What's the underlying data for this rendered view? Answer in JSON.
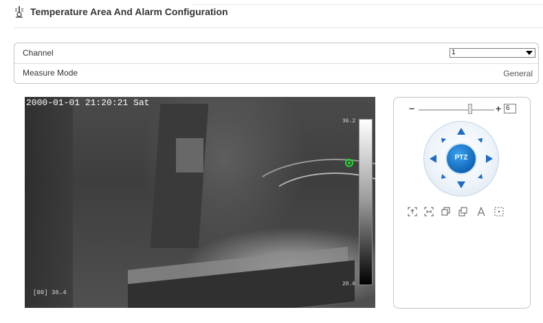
{
  "header": {
    "title": "Temperature Area And Alarm Configuration",
    "icon": "thermometer-icon"
  },
  "config": {
    "channel_label": "Channel",
    "channel_value": "1",
    "measure_mode_label": "Measure Mode",
    "measure_mode_value": "General"
  },
  "video": {
    "timestamp": "2000-01-01 21:20:21 Sat",
    "scale_max": "36.2",
    "scale_min": "20.6",
    "readout": "[00] 36.4"
  },
  "ptz": {
    "zoom_minus": "−",
    "zoom_plus": "+",
    "zoom_value": "6",
    "zoom_level": 6,
    "center_label": "PTZ",
    "tools": [
      "zoom-in-icon",
      "zoom-out-icon",
      "focus-near-icon",
      "focus-far-icon",
      "auto-focus-icon",
      "iris-icon"
    ]
  },
  "colors": {
    "accent_blue": "#1d6bc4",
    "marker_green": "#1edc2c"
  }
}
